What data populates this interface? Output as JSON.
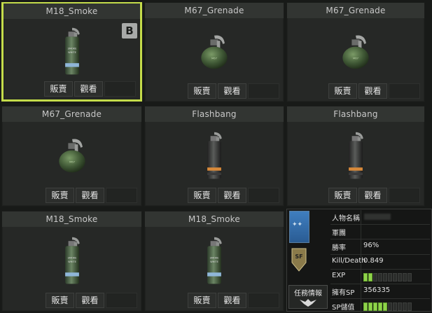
{
  "colors": {
    "selected_border": "#c4dc4a",
    "exp_bar": "#8ed34a",
    "rank_blue": "#3f7ebf"
  },
  "items": [
    {
      "name": "M18_Smoke",
      "type": "smoke",
      "selected": true,
      "badge": "B"
    },
    {
      "name": "M67_Grenade",
      "type": "frag"
    },
    {
      "name": "M67_Grenade",
      "type": "frag"
    },
    {
      "name": "M67_Grenade",
      "type": "frag"
    },
    {
      "name": "Flashbang",
      "type": "flash"
    },
    {
      "name": "Flashbang",
      "type": "flash"
    },
    {
      "name": "M18_Smoke",
      "type": "smoke"
    },
    {
      "name": "M18_Smoke",
      "type": "smoke"
    }
  ],
  "buttons": {
    "sell": "販賣",
    "view": "觀看"
  },
  "player": {
    "mission_label": "任務情報",
    "rows": [
      {
        "label": "人物名稱",
        "value": ""
      },
      {
        "label": "軍團",
        "value": ""
      },
      {
        "label": "勝率",
        "value": "96%"
      },
      {
        "label": "Kill/Death",
        "value": "0.849"
      },
      {
        "label": "EXP",
        "value": ""
      },
      {
        "label": "擁有SP",
        "value": "356335"
      },
      {
        "label": "SP儲值",
        "value": ""
      }
    ],
    "exp_level": 0.2,
    "sp_level": 0.5
  }
}
